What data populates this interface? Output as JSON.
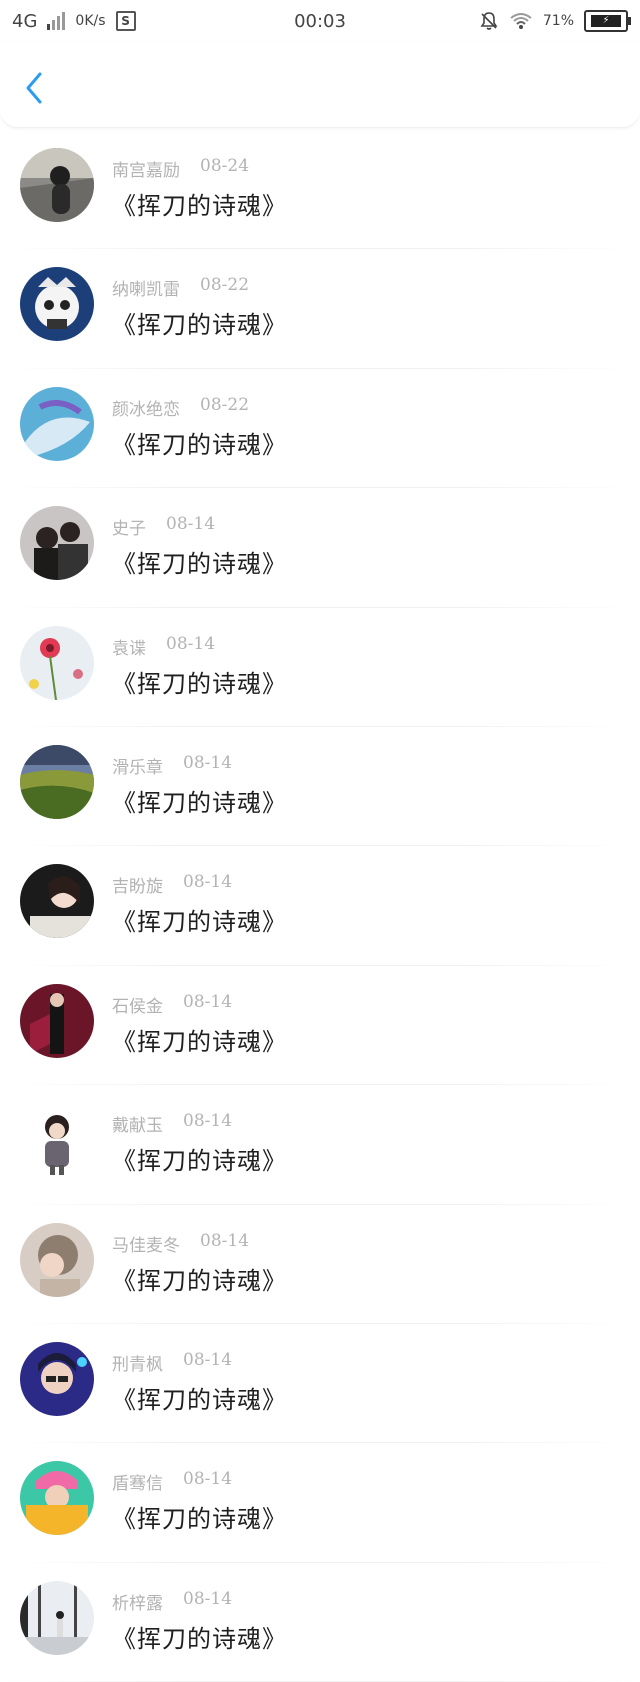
{
  "status_bar": {
    "network": "4G",
    "speed": "0K/s",
    "sync_icon": "S",
    "time": "00:03",
    "battery_percent": "71%",
    "icons": [
      "mute-bell-icon",
      "wifi-icon",
      "battery-icon"
    ]
  },
  "header": {
    "back_icon": "chevron-left-icon",
    "accent_color": "#2b9bf4"
  },
  "list": [
    {
      "name": "南宫嘉励",
      "date": "08-24",
      "title": "《挥刀的诗魂》"
    },
    {
      "name": "纳喇凯雷",
      "date": "08-22",
      "title": "《挥刀的诗魂》"
    },
    {
      "name": "颜冰绝恋",
      "date": "08-22",
      "title": "《挥刀的诗魂》"
    },
    {
      "name": "史子",
      "date": "08-14",
      "title": "《挥刀的诗魂》"
    },
    {
      "name": "袁谍",
      "date": "08-14",
      "title": "《挥刀的诗魂》"
    },
    {
      "name": "滑乐章",
      "date": "08-14",
      "title": "《挥刀的诗魂》"
    },
    {
      "name": "吉盼旋",
      "date": "08-14",
      "title": "《挥刀的诗魂》"
    },
    {
      "name": "石侯金",
      "date": "08-14",
      "title": "《挥刀的诗魂》"
    },
    {
      "name": "戴献玉",
      "date": "08-14",
      "title": "《挥刀的诗魂》"
    },
    {
      "name": "马佳麦冬",
      "date": "08-14",
      "title": "《挥刀的诗魂》"
    },
    {
      "name": "刑青枫",
      "date": "08-14",
      "title": "《挥刀的诗魂》"
    },
    {
      "name": "盾骞信",
      "date": "08-14",
      "title": "《挥刀的诗魂》"
    },
    {
      "name": "析梓露",
      "date": "08-14",
      "title": "《挥刀的诗魂》"
    }
  ]
}
